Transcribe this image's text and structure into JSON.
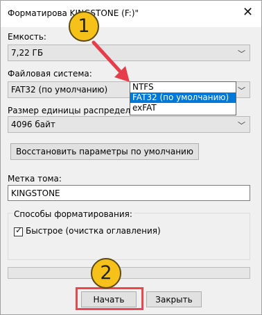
{
  "window": {
    "title": "Форматирование \"KINGSTONE (F:)\"",
    "title_visible": "Форматирова   KINGSTONE (F:)\"",
    "close_symbol": "✕"
  },
  "capacity": {
    "label": "Емкость:",
    "value": "7,22 ГБ"
  },
  "filesystem": {
    "label": "Файловая система:",
    "value": "FAT32 (по умолчанию)",
    "options": [
      "NTFS",
      "FAT32 (по умолчанию)",
      "exFAT"
    ],
    "selected_index": 1
  },
  "allocation": {
    "label": "Размер единицы распределения:",
    "label_visible": "Размер единицы распределени",
    "value": "4096 байт"
  },
  "restore_button": "Восстановить параметры по умолчанию",
  "volume": {
    "label": "Метка тома:",
    "value": "KINGSTONE"
  },
  "format_options": {
    "label": "Способы форматирования:",
    "quick_label": "Быстрое (очистка оглавления)",
    "quick_checked": true,
    "check_glyph": "✓"
  },
  "buttons": {
    "start": "Начать",
    "close": "Закрыть"
  },
  "annotations": {
    "step1": "1",
    "step2": "2",
    "highlight_color": "#e64a50",
    "badge_color": "#f6c21a"
  },
  "icons": {
    "dropdown_arrow": "﹀",
    "close": "close-icon",
    "arrow": "red-arrow-icon"
  }
}
